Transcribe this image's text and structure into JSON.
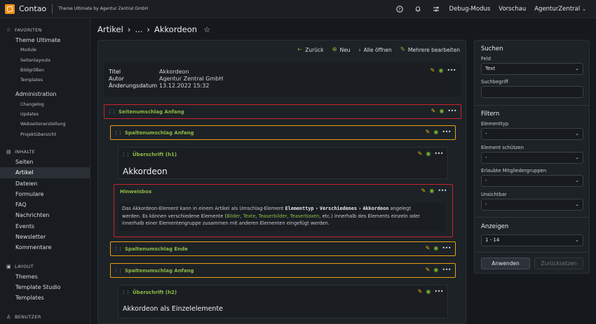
{
  "app": {
    "brand": "Contao",
    "subbrand": "Theme Ultimate by Agentur Zentral GmbH"
  },
  "topnav": {
    "debug": "Debug-Modus",
    "preview": "Vorschau",
    "user": "AgenturZentral"
  },
  "sidebar": {
    "favoriten": {
      "heading": "FAVORITEN",
      "items": [
        {
          "label": "Theme Ultimate",
          "subs": [
            "Module",
            "Seitenlayouts",
            "Bildgrößen",
            "Templates"
          ]
        },
        {
          "label": "Administration",
          "subs": [
            "Changelog",
            "Updates",
            "Webseitenerstellung",
            "Projektübersicht"
          ]
        }
      ]
    },
    "inhalte": {
      "heading": "INHALTE",
      "items": [
        "Seiten",
        "Artikel",
        "Dateien",
        "Formulare",
        "FAQ",
        "Nachrichten",
        "Events",
        "Newsletter",
        "Kommentare"
      ]
    },
    "layout": {
      "heading": "LAYOUT",
      "items": [
        "Themes",
        "Template Studio",
        "Templates"
      ]
    },
    "benutzer": {
      "heading": "BENUTZER"
    }
  },
  "breadcrumb": {
    "part1": "Artikel",
    "sep1": "›",
    "part2": "...",
    "sep2": "›",
    "part3": "Akkordeon"
  },
  "toolbar": {
    "back": "Zurück",
    "new": "Neu",
    "open_all": "Alle öffnen",
    "edit_multiple": "Mehrere bearbeiten"
  },
  "meta": {
    "title_k": "Titel",
    "title_v": "Akkordeon",
    "author_k": "Autor",
    "author_v": "Agentur Zentral GmbH",
    "date_k": "Änderungsdatum",
    "date_v": "13.12.2022 15:32"
  },
  "elements": {
    "wrap_start": "Seitenumschlag Anfang",
    "col_start_1": "Spaltenumschlag Anfang",
    "headline_h1_type": "Überschrift (h1)",
    "headline_h1_text": "Akkordeon",
    "hint_type": "Hinweisbox",
    "hint_p1": "Das Akkordeon-Element kann in einem Artikel als Umschlag-Element",
    "hint_code1": "Elementtyp",
    "hint_arrow1": "›",
    "hint_code2": "Verschiedenes",
    "hint_arrow2": "›",
    "hint_code3": "Akkordeon",
    "hint_p2": "angelegt",
    "hint_p3": "werden. Es können verschiedene Elemente (",
    "hint_l1": "Bilder",
    "hint_c1": ", ",
    "hint_l2": "Texte",
    "hint_c2": ", ",
    "hint_l3": "Teaserbilder",
    "hint_c3": ", ",
    "hint_l4": "Teaserboxen",
    "hint_p4": ", etc.) innerhalb des Elements einzeln oder",
    "hint_p5": "innerhalb einer Elementengruppe zusammen mit anderen Elementen eingefügt werden.",
    "col_end": "Spaltenumschlag Ende",
    "col_start_2": "Spaltenumschlag Anfang",
    "headline_h2_type": "Überschrift (h2)",
    "headline_h2_text": "Akkordeon als Einzelelemente"
  },
  "right_panel": {
    "search_heading": "Suchen",
    "field_label": "Feld",
    "field_value": "Text",
    "term_label": "Suchbegriff",
    "filter_heading": "Filtern",
    "f1_label": "Elementtyp",
    "f1_value": "-",
    "f2_label": "Element schützen",
    "f2_value": "-",
    "f3_label": "Erlaubte Mitgliedergruppen",
    "f3_value": "-",
    "f4_label": "Unsichtbar",
    "f4_value": "-",
    "show_heading": "Anzeigen",
    "show_value": "1 - 14",
    "apply": "Anwenden",
    "reset": "Zurücksetzen"
  },
  "colors": {
    "accent_green": "#8ebc43",
    "red_border": "#c9242c",
    "orange_border": "#e8a012",
    "pencil": "#f2b705",
    "logo": "#f28c13"
  }
}
